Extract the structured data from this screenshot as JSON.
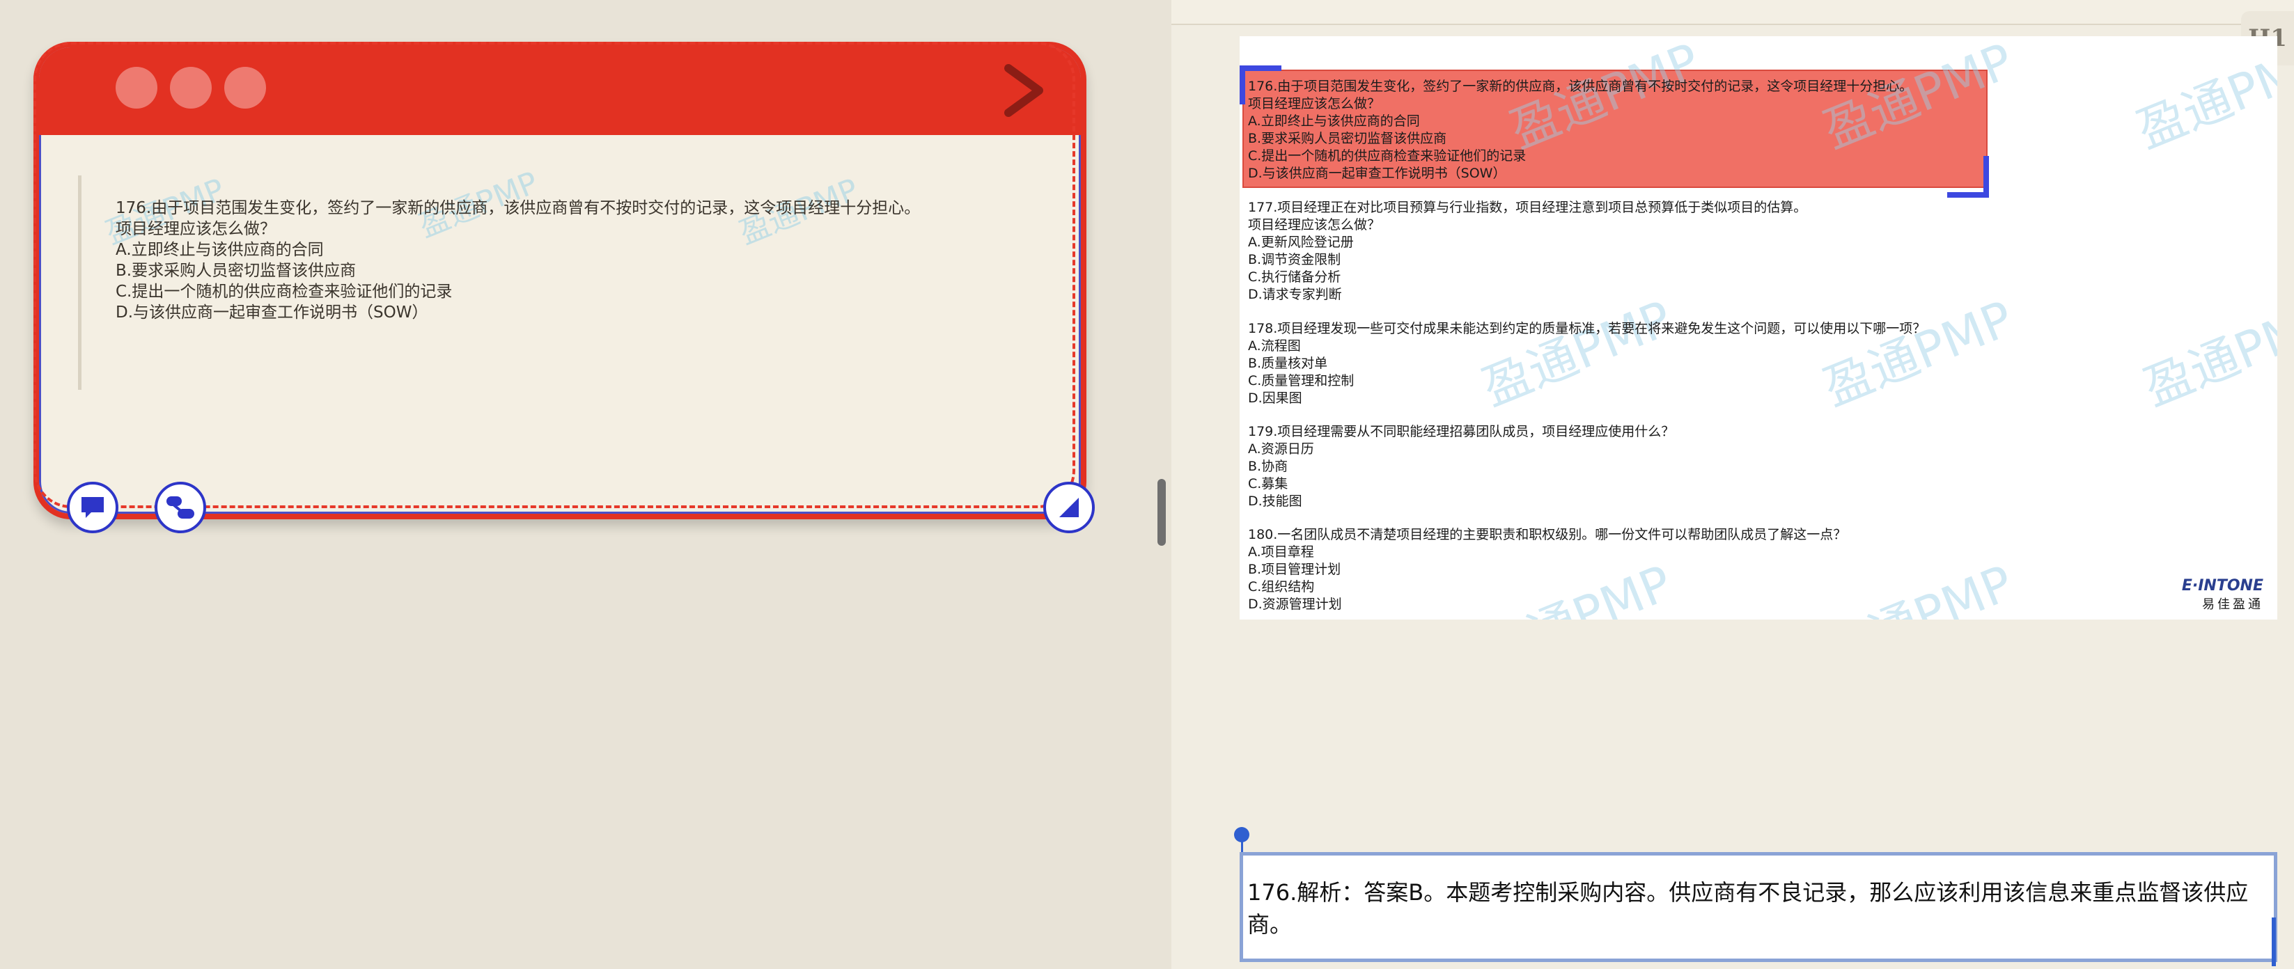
{
  "card": {
    "question_lines": [
      "176.由于项目范围发生变化，签约了一家新的供应商，该供应商曾有不按时交付的记录，这令项目经理十分担心。",
      "项目经理应该怎么做？",
      "A.立即终止与该供应商的合同",
      "B.要求采购人员密切监督该供应商",
      "C.提出一个随机的供应商检查来验证他们的记录",
      "D.与该供应商一起审查工作说明书（SOW）"
    ],
    "watermark": "盈通PMP"
  },
  "toolbar": {
    "h1_label": "H1"
  },
  "document": {
    "questions": [
      {
        "lines": [
          "176.由于项目范围发生变化，签约了一家新的供应商，该供应商曾有不按时交付的记录，这令项目经理十分担心。",
          "项目经理应该怎么做？",
          "A.立即终止与该供应商的合同",
          "B.要求采购人员密切监督该供应商",
          "C.提出一个随机的供应商检查来验证他们的记录",
          "D.与该供应商一起审查工作说明书（SOW）"
        ]
      },
      {
        "lines": [
          "177.项目经理正在对比项目预算与行业指数，项目经理注意到项目总预算低于类似项目的估算。",
          "项目经理应该怎么做？",
          "A.更新风险登记册",
          "B.调节资金限制",
          "C.执行储备分析",
          "D.请求专家判断"
        ]
      },
      {
        "lines": [
          "178.项目经理发现一些可交付成果未能达到约定的质量标准，若要在将来避免发生这个问题，可以使用以下哪一项？",
          "A.流程图",
          "B.质量核对单",
          "C.质量管理和控制",
          "D.因果图"
        ]
      },
      {
        "lines": [
          "179.项目经理需要从不同职能经理招募团队成员，项目经理应使用什么？",
          "A.资源日历",
          "B.协商",
          "C.募集",
          "D.技能图"
        ]
      },
      {
        "lines": [
          "180.一名团队成员不清楚项目经理的主要职责和职权级别。哪一份文件可以帮助团队成员了解这一点？",
          "A.项目章程",
          "B.项目管理计划",
          "C.组织结构",
          "D.资源管理计划"
        ]
      }
    ],
    "watermark": "盈通PMP",
    "logo_brand": "E·INTONE",
    "logo_cn": "易佳盈通"
  },
  "explanation": {
    "text": "176.解析：答案B。本题考控制采购内容。供应商有不良记录，那么应该利用该信息来重点监督该供应商。"
  }
}
